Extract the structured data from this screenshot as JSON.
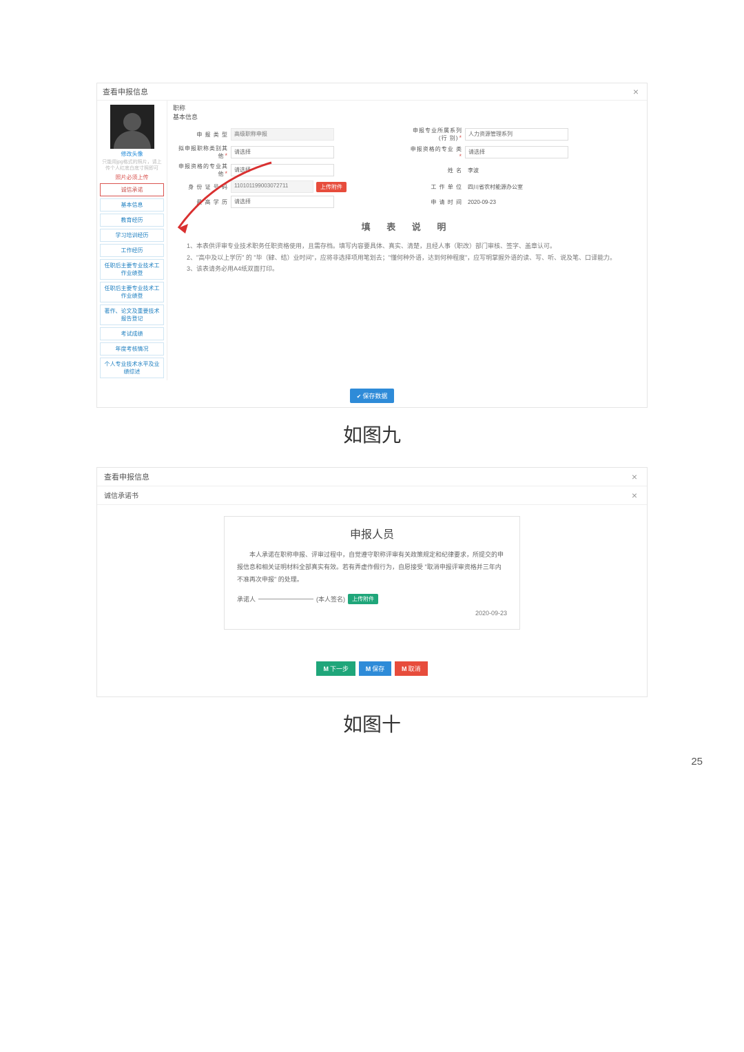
{
  "dlg1": {
    "title": "查看申报信息",
    "group1": "职称",
    "group2": "基本信息",
    "avatar_caption": "修改头像",
    "avatar_hint": "只能用jpg格式的照片，请上传个人红底白底寸照即可",
    "avatar_link": "照片必须上传",
    "nav": [
      "诚信承诺",
      "基本信息",
      "教育经历",
      "学习培训经历",
      "工作经历",
      "任职后主要专业技术工作业绩登",
      "任职后主要专业技术工作业绩登",
      "著作、论文及重要技术报告登记",
      "考试成绩",
      "年度考核情况",
      "个人专业技术水平及业绩综述"
    ],
    "fields": {
      "apply_type_lbl": "申 报 类 型",
      "apply_type_val": "高级职称申报",
      "series_lbl": "申报专业所属系列(行    别)",
      "series_val": "人力资源管理系列",
      "same_class_lbl": "拟申报职称类别其    他",
      "same_class_val": "请选择",
      "grade_lbl": "申报资格的专业    类",
      "grade_val": "请选择",
      "spec_lbl": "申报资格的专业其    他",
      "spec_val": "请选择",
      "name_lbl": "姓    名",
      "name_val": "李波",
      "id_lbl": "身 份 证 号 码",
      "id_val": "110101199003072711",
      "upload_btn": "上传附件",
      "unit_lbl": "工 作 单 位",
      "unit_val": "四川省农村能源办公室",
      "highest_lbl": "最 高 学 历",
      "highest_val": "请选择",
      "date_lbl": "申 请 时 间",
      "date_val": "2020-09-23"
    },
    "instructions_title": "填 表 说 明",
    "instructions": [
      "1、本表供评审专业技术职务任职资格使用，且需存档。填写内容要具体、真实、清楚，且经人事（职改）部门审核、签字、盖章认可。",
      "2、\"高中及以上学历\" 的 \"毕（肄、结）业时间\"，应将非选择项用笔划去；\"懂何种外语，达到何种程度\"，应写明掌握外语的读、写、听、说及笔、口译能力。",
      "3、该表请务必用A4纸双面打印。"
    ],
    "save_btn": "保存数据"
  },
  "caption1": "如图九",
  "dlg2": {
    "title": "查看申报信息",
    "subtitle": "诚信承诺书",
    "heading": "申报人员",
    "body": "本人承诺在职称申报、评审过程中，自觉遵守职称评审有关政策规定和纪律要求，所提交的申报信息和相关证明材料全部真实有效。若有弄虚作假行为，自愿接受 \"取消申报评审资格并三年内不准再次申报\" 的处理。",
    "sign_label": "承诺人",
    "sign_hint": "(本人签名)",
    "upload_btn": "上传附件",
    "date": "2020-09-23",
    "next_btn": "下一步",
    "save_btn": "保存",
    "cancel_btn": "取消"
  },
  "caption2": "如图十",
  "page_number": "25"
}
